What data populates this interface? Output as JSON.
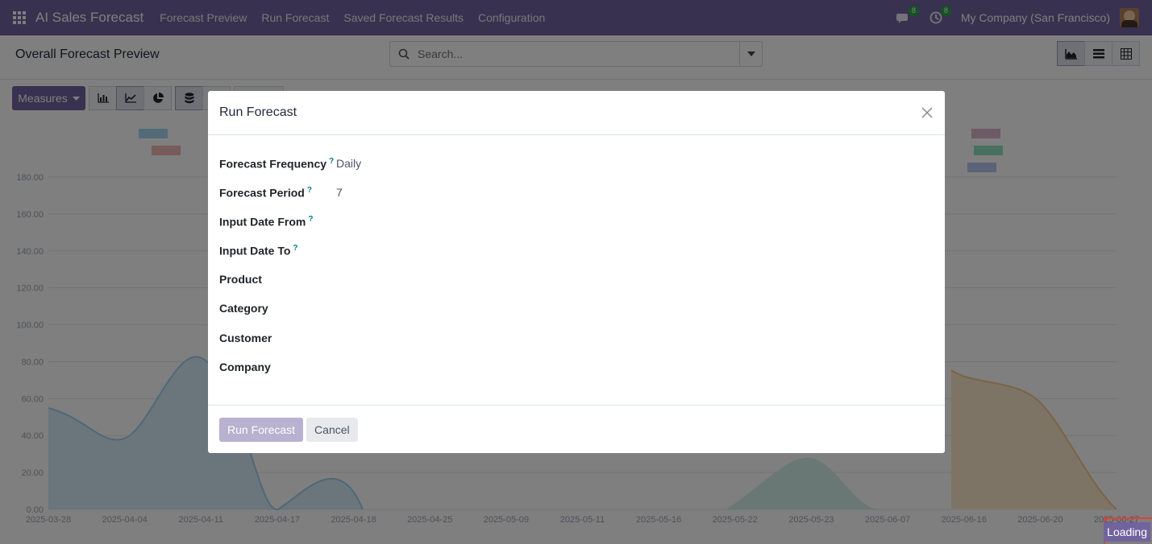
{
  "navbar": {
    "brand": "AI Sales Forecast",
    "menus": [
      "Forecast Preview",
      "Run Forecast",
      "Saved Forecast Results",
      "Configuration"
    ],
    "messages_count": "8",
    "activities_count": "8",
    "company": "My Company (San Francisco)"
  },
  "control_panel": {
    "breadcrumb": "Overall Forecast Preview",
    "search_placeholder": "Search...",
    "measures_label": "Measures"
  },
  "chart_data": {
    "type": "area",
    "x": [
      "2025-03-28",
      "2025-04-04",
      "2025-04-11",
      "2025-04-17",
      "2025-04-18",
      "2025-04-25",
      "2025-05-09",
      "2025-05-11",
      "2025-05-16",
      "2025-05-22",
      "2025-05-23",
      "2025-06-07",
      "2025-06-16",
      "2025-06-20",
      "2025-06-27"
    ],
    "ytick_labels": [
      "0.00",
      "20.00",
      "40.00",
      "60.00",
      "80.00",
      "100.00",
      "120.00",
      "140.00",
      "160.00",
      "180.00"
    ],
    "ylim": [
      0,
      180
    ]
  },
  "dialog": {
    "title": "Run Forecast",
    "fields": [
      {
        "label": "Forecast Frequency",
        "value": "Daily",
        "help": "?"
      },
      {
        "label": "Forecast Period",
        "value": "7",
        "help": "?"
      },
      {
        "label": "Input Date From",
        "value": "",
        "help": "?"
      },
      {
        "label": "Input Date To",
        "value": "",
        "help": "?"
      },
      {
        "label": "Product",
        "value": ""
      },
      {
        "label": "Category",
        "value": ""
      },
      {
        "label": "Customer",
        "value": ""
      },
      {
        "label": "Company",
        "value": ""
      }
    ],
    "primary_button": "Run Forecast",
    "cancel_button": "Cancel"
  },
  "status": {
    "loading_text": "Loading"
  },
  "colors": {
    "brand": "#71639e",
    "badge": "#28a745",
    "help": "#017e84"
  }
}
